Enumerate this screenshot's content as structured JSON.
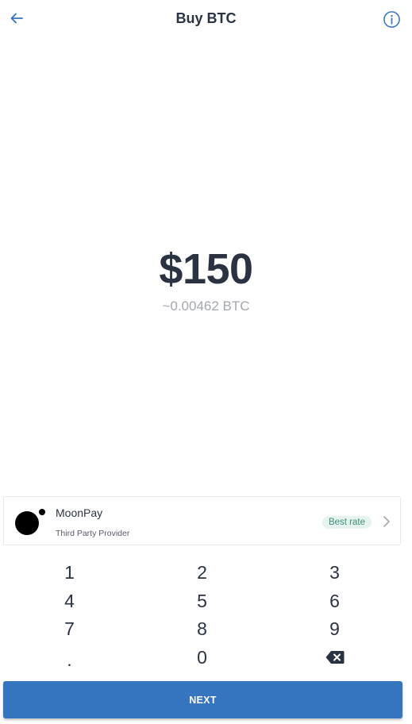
{
  "header": {
    "title": "Buy BTC",
    "back_icon": "arrow-left-icon",
    "info_icon": "info-circle-icon"
  },
  "amount": {
    "fiat": "$150",
    "crypto": "~0.00462 BTC"
  },
  "provider": {
    "name": "MoonPay",
    "subtitle": "Third Party Provider",
    "badge": "Best rate",
    "logo_icon": "moonpay-logo",
    "chevron_icon": "chevron-right-icon"
  },
  "keypad": {
    "keys": [
      "1",
      "2",
      "3",
      "4",
      "5",
      "6",
      "7",
      "8",
      "9",
      ".",
      "0",
      "backspace"
    ]
  },
  "actions": {
    "next_label": "NEXT"
  },
  "colors": {
    "accent": "#3574be",
    "text": "#2b3342",
    "muted": "#a3a7ae",
    "badge_bg": "#e6f3ef",
    "badge_text": "#3d8f7a"
  }
}
